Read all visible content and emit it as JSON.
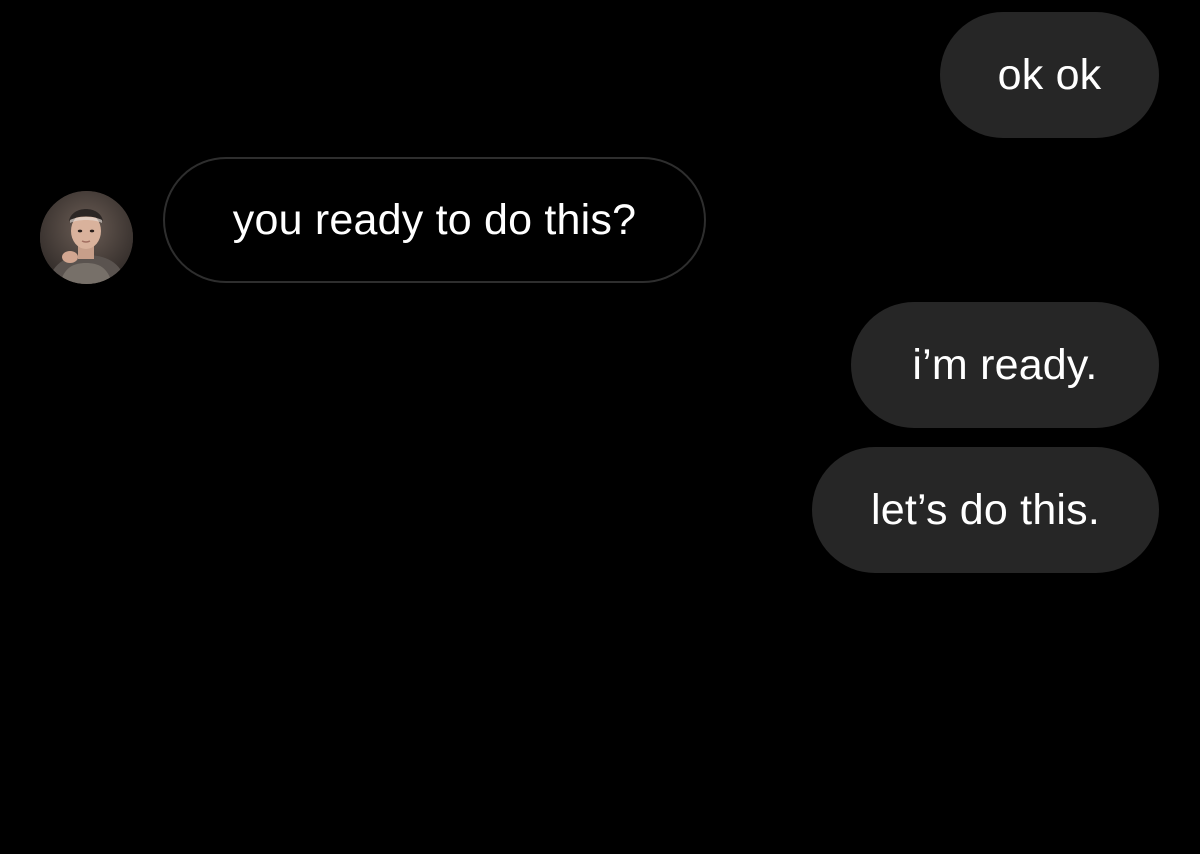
{
  "conversation": {
    "messages": [
      {
        "sender": "me",
        "text": "ok ok"
      },
      {
        "sender": "them",
        "text": "you ready to do this?"
      },
      {
        "sender": "me",
        "text": "i’m ready."
      },
      {
        "sender": "me",
        "text": "let’s do this."
      }
    ]
  },
  "contact": {
    "avatar_icon": "profile-photo-avatar"
  },
  "colors": {
    "background": "#000000",
    "sent_bubble": "#262626",
    "received_bubble_border": "#2e2e2e",
    "text": "#ffffff"
  }
}
